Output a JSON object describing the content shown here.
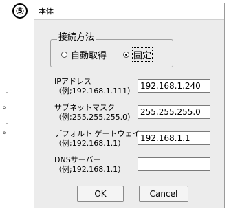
{
  "step_badge": "⑤",
  "left_marks": [
    "-",
    "。",
    "-",
    "。"
  ],
  "window": {
    "title": "本体",
    "connection": {
      "legend": "接続方法",
      "option_auto": "自動取得",
      "option_fixed": "固定",
      "selected": "固定"
    },
    "fields": [
      {
        "label": "IPアドレス",
        "example": "（例;192.168.1.111）",
        "value": "192.168.1.240"
      },
      {
        "label": "サブネットマスク",
        "example": "（例;255.255.255.0）",
        "value": "255.255.255.0"
      },
      {
        "label": "デフォルト ゲートウェイ",
        "example": "（例;192.168.1.1）",
        "value": "192.168.1.1"
      },
      {
        "label": "DNSサーバー",
        "example": "（例;192.168.1.1）",
        "value": ""
      }
    ],
    "ok_label": "OK",
    "cancel_label": "Cancel"
  }
}
